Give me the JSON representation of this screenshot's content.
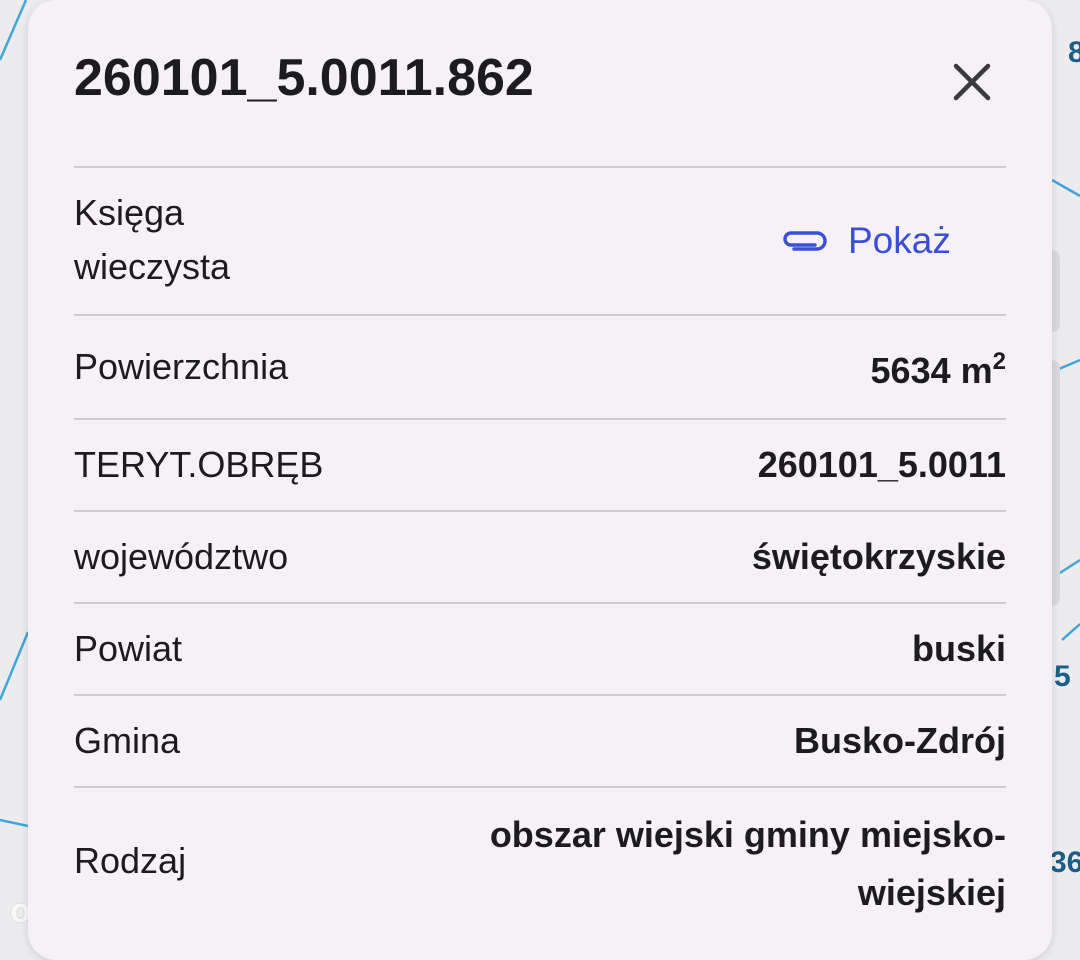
{
  "map": {
    "labels": [
      "8",
      "5",
      "36"
    ]
  },
  "watermark": "otodam",
  "card": {
    "title": "260101_5.0011.862",
    "close_icon": "close-icon",
    "rows": [
      {
        "label": "Księga\nwieczysta",
        "link_label": "Pokaż",
        "link_icon": "paperclip-icon"
      },
      {
        "label": "Powierzchnia",
        "value": "5634 m",
        "value_sup": "2"
      },
      {
        "label": "TERYT.OBRĘB",
        "value": "260101_5.0011"
      },
      {
        "label": "województwo",
        "value": "świętokrzyskie"
      },
      {
        "label": "Powiat",
        "value": "buski"
      },
      {
        "label": "Gmina",
        "value": "Busko-Zdrój"
      },
      {
        "label": "Rodzaj",
        "value": "obszar wiejski gminy miejsko-\nwiejskiej"
      }
    ]
  },
  "colors": {
    "card_bg": "#f5f1f6",
    "link": "#3b4fd6",
    "text": "#1c1b1f",
    "divider": "#cfcbd3",
    "map_line": "#3aa0d6"
  }
}
